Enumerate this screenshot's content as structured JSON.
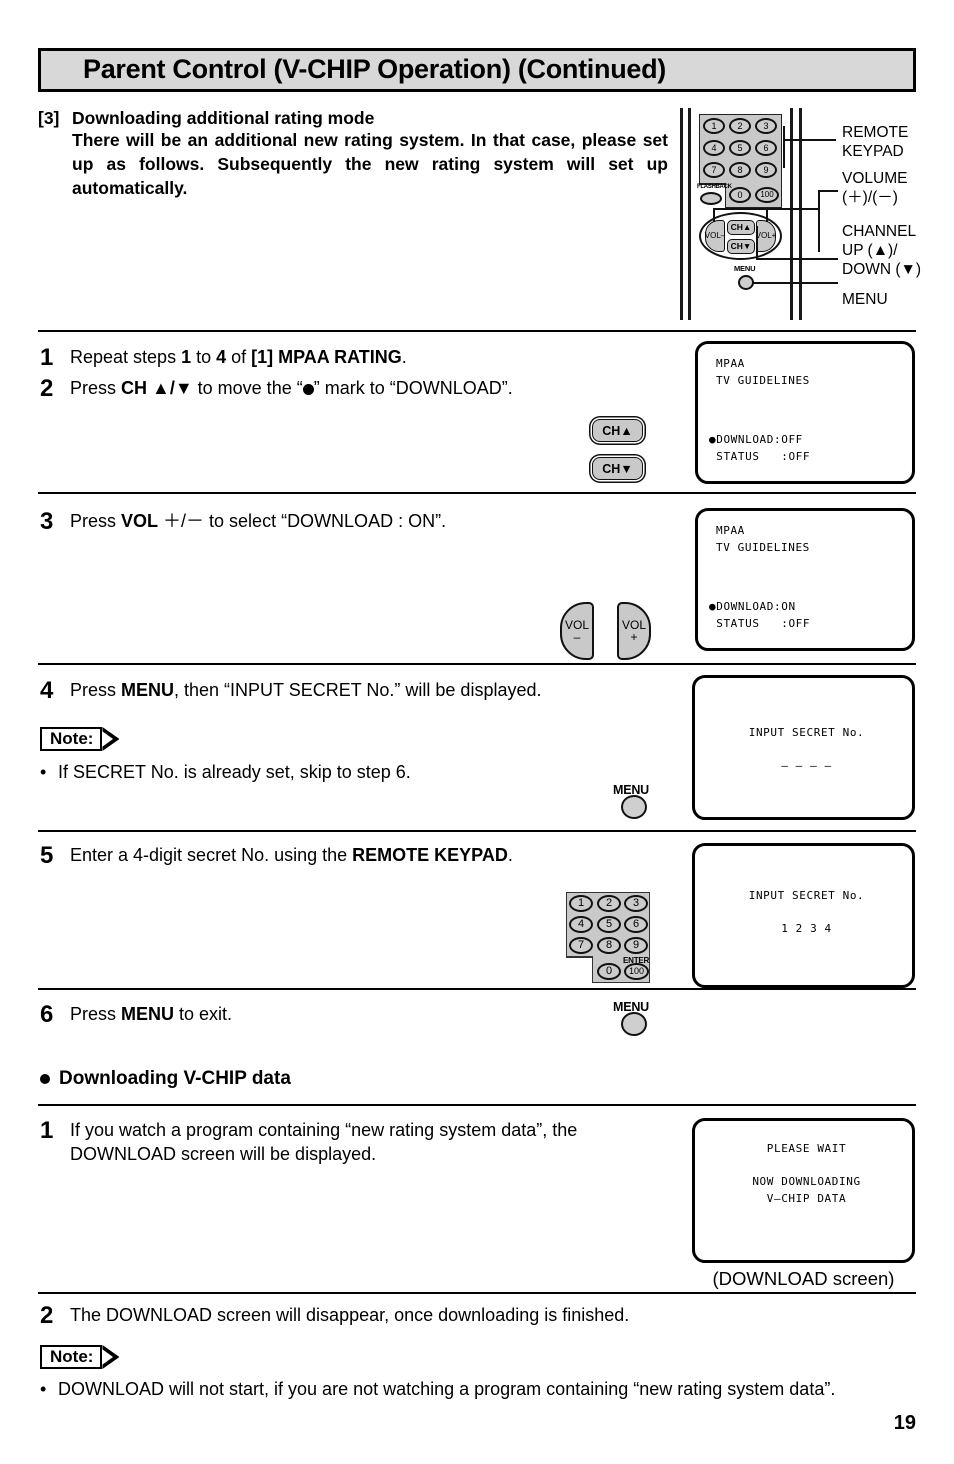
{
  "header": {
    "title": "Parent Control (V-CHIP Operation) (Continued)"
  },
  "intro": {
    "tag": "[3]",
    "heading": "Downloading additional rating mode",
    "body": "There will be an additional new rating system. In that case, please set up as follows. Subsequently the new rating system will set up automatically."
  },
  "remote": {
    "keys": {
      "k1": "1",
      "k2": "2",
      "k3": "3",
      "k4": "4",
      "k5": "5",
      "k6": "6",
      "k7": "7",
      "k8": "8",
      "k9": "9",
      "k0": "0",
      "k100": "100",
      "flashback": "FLASHBACK",
      "vol_minus": "VOL",
      "vol_minus_sign": "–",
      "vol_plus": "VOL",
      "vol_plus_sign": "+",
      "ch_up": "CH▲",
      "ch_down": "CH▼",
      "menu": "MENU"
    },
    "callouts": {
      "keypad_line1": "REMOTE",
      "keypad_line2": "KEYPAD",
      "volume_line1": "VOLUME",
      "volume_line2": "(＋)/(－)",
      "channel_line1": "CHANNEL",
      "channel_line2": "UP (▲)/",
      "channel_line3": "DOWN (▼)",
      "menu": "MENU"
    }
  },
  "steps": {
    "s1": {
      "num": "1",
      "parts": [
        "Repeat steps ",
        "1",
        " to ",
        "4",
        " of ",
        "[1] MPAA RATING",
        "."
      ]
    },
    "s2": {
      "num": "2",
      "pre": "Press ",
      "bold": "CH ▲/▼",
      "mid": "  to move the “",
      "post": "” mark to “DOWNLOAD”."
    },
    "s3": {
      "num": "3",
      "pre": "Press ",
      "bold": "VOL",
      "post": "  ＋/－  to select “DOWNLOAD : ON”."
    },
    "s4": {
      "num": "4",
      "pre": "Press ",
      "bold": "MENU",
      "post": ", then “INPUT SECRET No.” will be displayed."
    },
    "s5": {
      "num": "5",
      "pre": "Enter a 4-digit secret No. using the ",
      "bold": "REMOTE KEYPAD",
      "post": "."
    },
    "s6": {
      "num": "6",
      "pre": "Press ",
      "bold": "MENU",
      "post": " to exit."
    }
  },
  "notes": {
    "note1": {
      "label": "Note:",
      "bullet_dot": "•",
      "text": "If SECRET No. is already set, skip to step 6."
    },
    "note2": {
      "label": "Note:",
      "bullet_dot": "•",
      "text": "DOWNLOAD will not start, if you are not watching a program containing “new rating system data”."
    }
  },
  "buttons": {
    "ch_up": "CH▲",
    "ch_down": "CH▼",
    "vol_label": "VOL",
    "vol_minus_sign": "–",
    "vol_plus_sign": "+",
    "menu": "MENU"
  },
  "keypad": {
    "k1": "1",
    "k2": "2",
    "k3": "3",
    "k4": "4",
    "k5": "5",
    "k6": "6",
    "k7": "7",
    "k8": "8",
    "k9": "9",
    "k0": "0",
    "k100": "100",
    "enter": "ENTER"
  },
  "screens": {
    "screen_step2": {
      "line1": "MPAA",
      "line2": "TV GUIDELINES",
      "line3": "●DOWNLOAD:OFF",
      "line4": " STATUS   :OFF"
    },
    "screen_step3": {
      "line1": "MPAA",
      "line2": "TV GUIDELINES",
      "line3": "●DOWNLOAD:ON",
      "line4": " STATUS   :OFF"
    },
    "screen_step4": {
      "line1": "INPUT SECRET No.",
      "line2": "– – – –"
    },
    "screen_step5": {
      "line1": "INPUT SECRET No.",
      "line2": "1 2 3 4"
    },
    "screen_download": {
      "line1": "PLEASE WAIT",
      "line2": "NOW DOWNLOADING",
      "line3": "V–CHIP DATA",
      "caption": "(DOWNLOAD  screen)"
    }
  },
  "section": {
    "download_vchip_heading": "Downloading V-CHIP data",
    "d1": {
      "num": "1",
      "text": "If you watch a program containing “new rating system data”, the DOWNLOAD screen will be displayed."
    },
    "d2": {
      "num": "2",
      "text": "The DOWNLOAD screen will disappear, once downloading is finished."
    }
  },
  "footer": {
    "page_number": "19"
  }
}
